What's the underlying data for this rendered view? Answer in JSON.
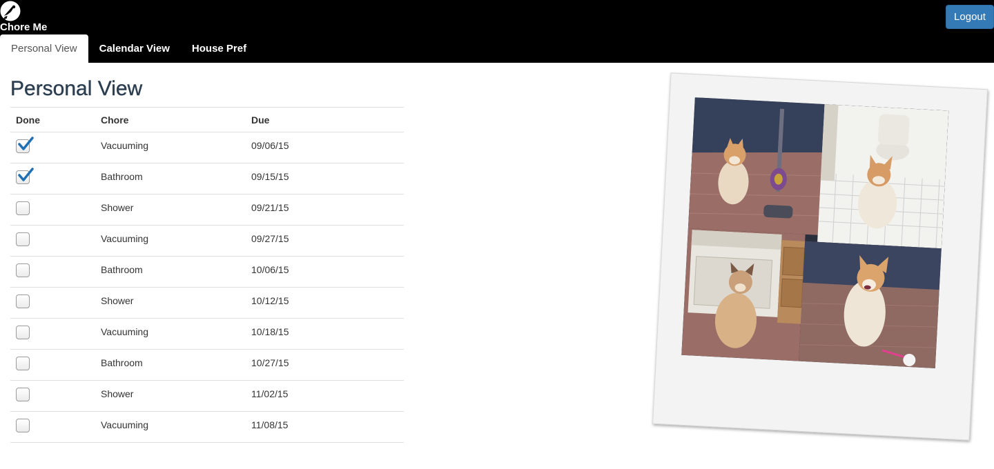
{
  "header": {
    "brand_name": "Chore Me",
    "logout_label": "Logout",
    "tabs": [
      {
        "label": "Personal View",
        "active": true
      },
      {
        "label": "Calendar View",
        "active": false
      },
      {
        "label": "House Pref",
        "active": false
      }
    ]
  },
  "main": {
    "title": "Personal View",
    "table": {
      "columns": [
        "Done",
        "Chore",
        "Due"
      ],
      "rows": [
        {
          "done": true,
          "chore": "Vacuuming",
          "due": "09/06/15"
        },
        {
          "done": true,
          "chore": "Bathroom",
          "due": "09/15/15"
        },
        {
          "done": false,
          "chore": "Shower",
          "due": "09/21/15"
        },
        {
          "done": false,
          "chore": "Vacuuming",
          "due": "09/27/15"
        },
        {
          "done": false,
          "chore": "Bathroom",
          "due": "10/06/15"
        },
        {
          "done": false,
          "chore": "Shower",
          "due": "10/12/15"
        },
        {
          "done": false,
          "chore": "Vacuuming",
          "due": "10/18/15"
        },
        {
          "done": false,
          "chore": "Bathroom",
          "due": "10/27/15"
        },
        {
          "done": false,
          "chore": "Shower",
          "due": "11/02/15"
        },
        {
          "done": false,
          "chore": "Vacuuming",
          "due": "11/08/15"
        }
      ]
    }
  },
  "colors": {
    "navbar_bg": "#000000",
    "logout_bg": "#337ab7",
    "title_color": "#2c3e50",
    "check_color": "#1f6fb5"
  },
  "icons": {
    "brand_logo": "broom-witch-logo-icon",
    "checked": "checkmark-icon"
  }
}
